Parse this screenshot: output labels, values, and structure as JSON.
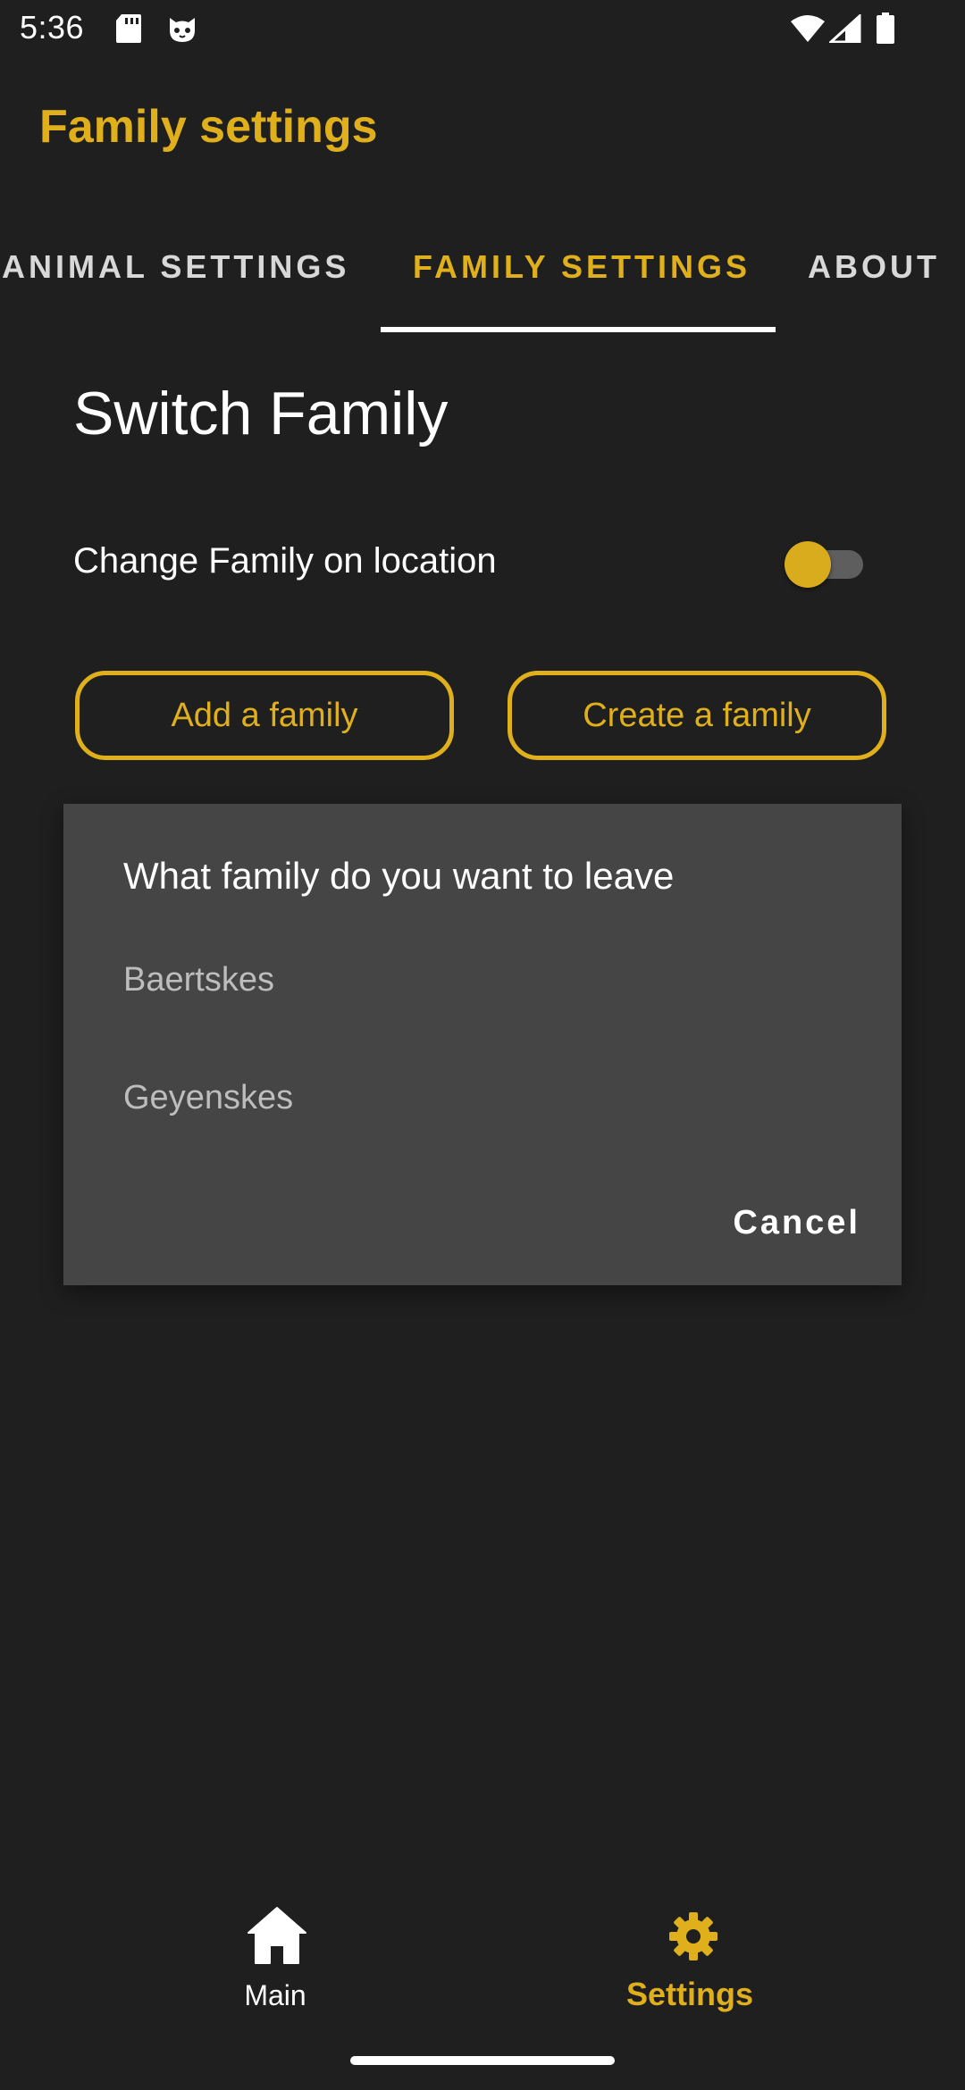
{
  "status_bar": {
    "time": "5:36",
    "icons": [
      "sd-card-icon",
      "cat-face-icon",
      "wifi-icon",
      "signal-icon",
      "battery-icon"
    ]
  },
  "app_bar": {
    "title": "Family settings"
  },
  "tabs": [
    {
      "label": "ANIMAL SETTINGS",
      "selected": false
    },
    {
      "label": "FAMILY SETTINGS",
      "selected": true
    },
    {
      "label": "ABOUT",
      "selected": false
    }
  ],
  "content": {
    "section_title": "Switch Family",
    "toggle": {
      "label": "Change Family on location",
      "on": false
    },
    "buttons": {
      "add_family": "Add a family",
      "create_family": "Create a family"
    }
  },
  "dialog": {
    "title": "What family do you want to leave",
    "items": [
      "Baertskes",
      "Geyenskes"
    ],
    "cancel": "Cancel"
  },
  "bottom_nav": {
    "items": [
      {
        "label": "Main",
        "icon": "home-icon",
        "selected": false
      },
      {
        "label": "Settings",
        "icon": "gear-icon",
        "selected": true
      }
    ]
  },
  "colors": {
    "accent": "#e0b01c",
    "background": "#1f1f1f",
    "dialog_background": "#454545"
  }
}
